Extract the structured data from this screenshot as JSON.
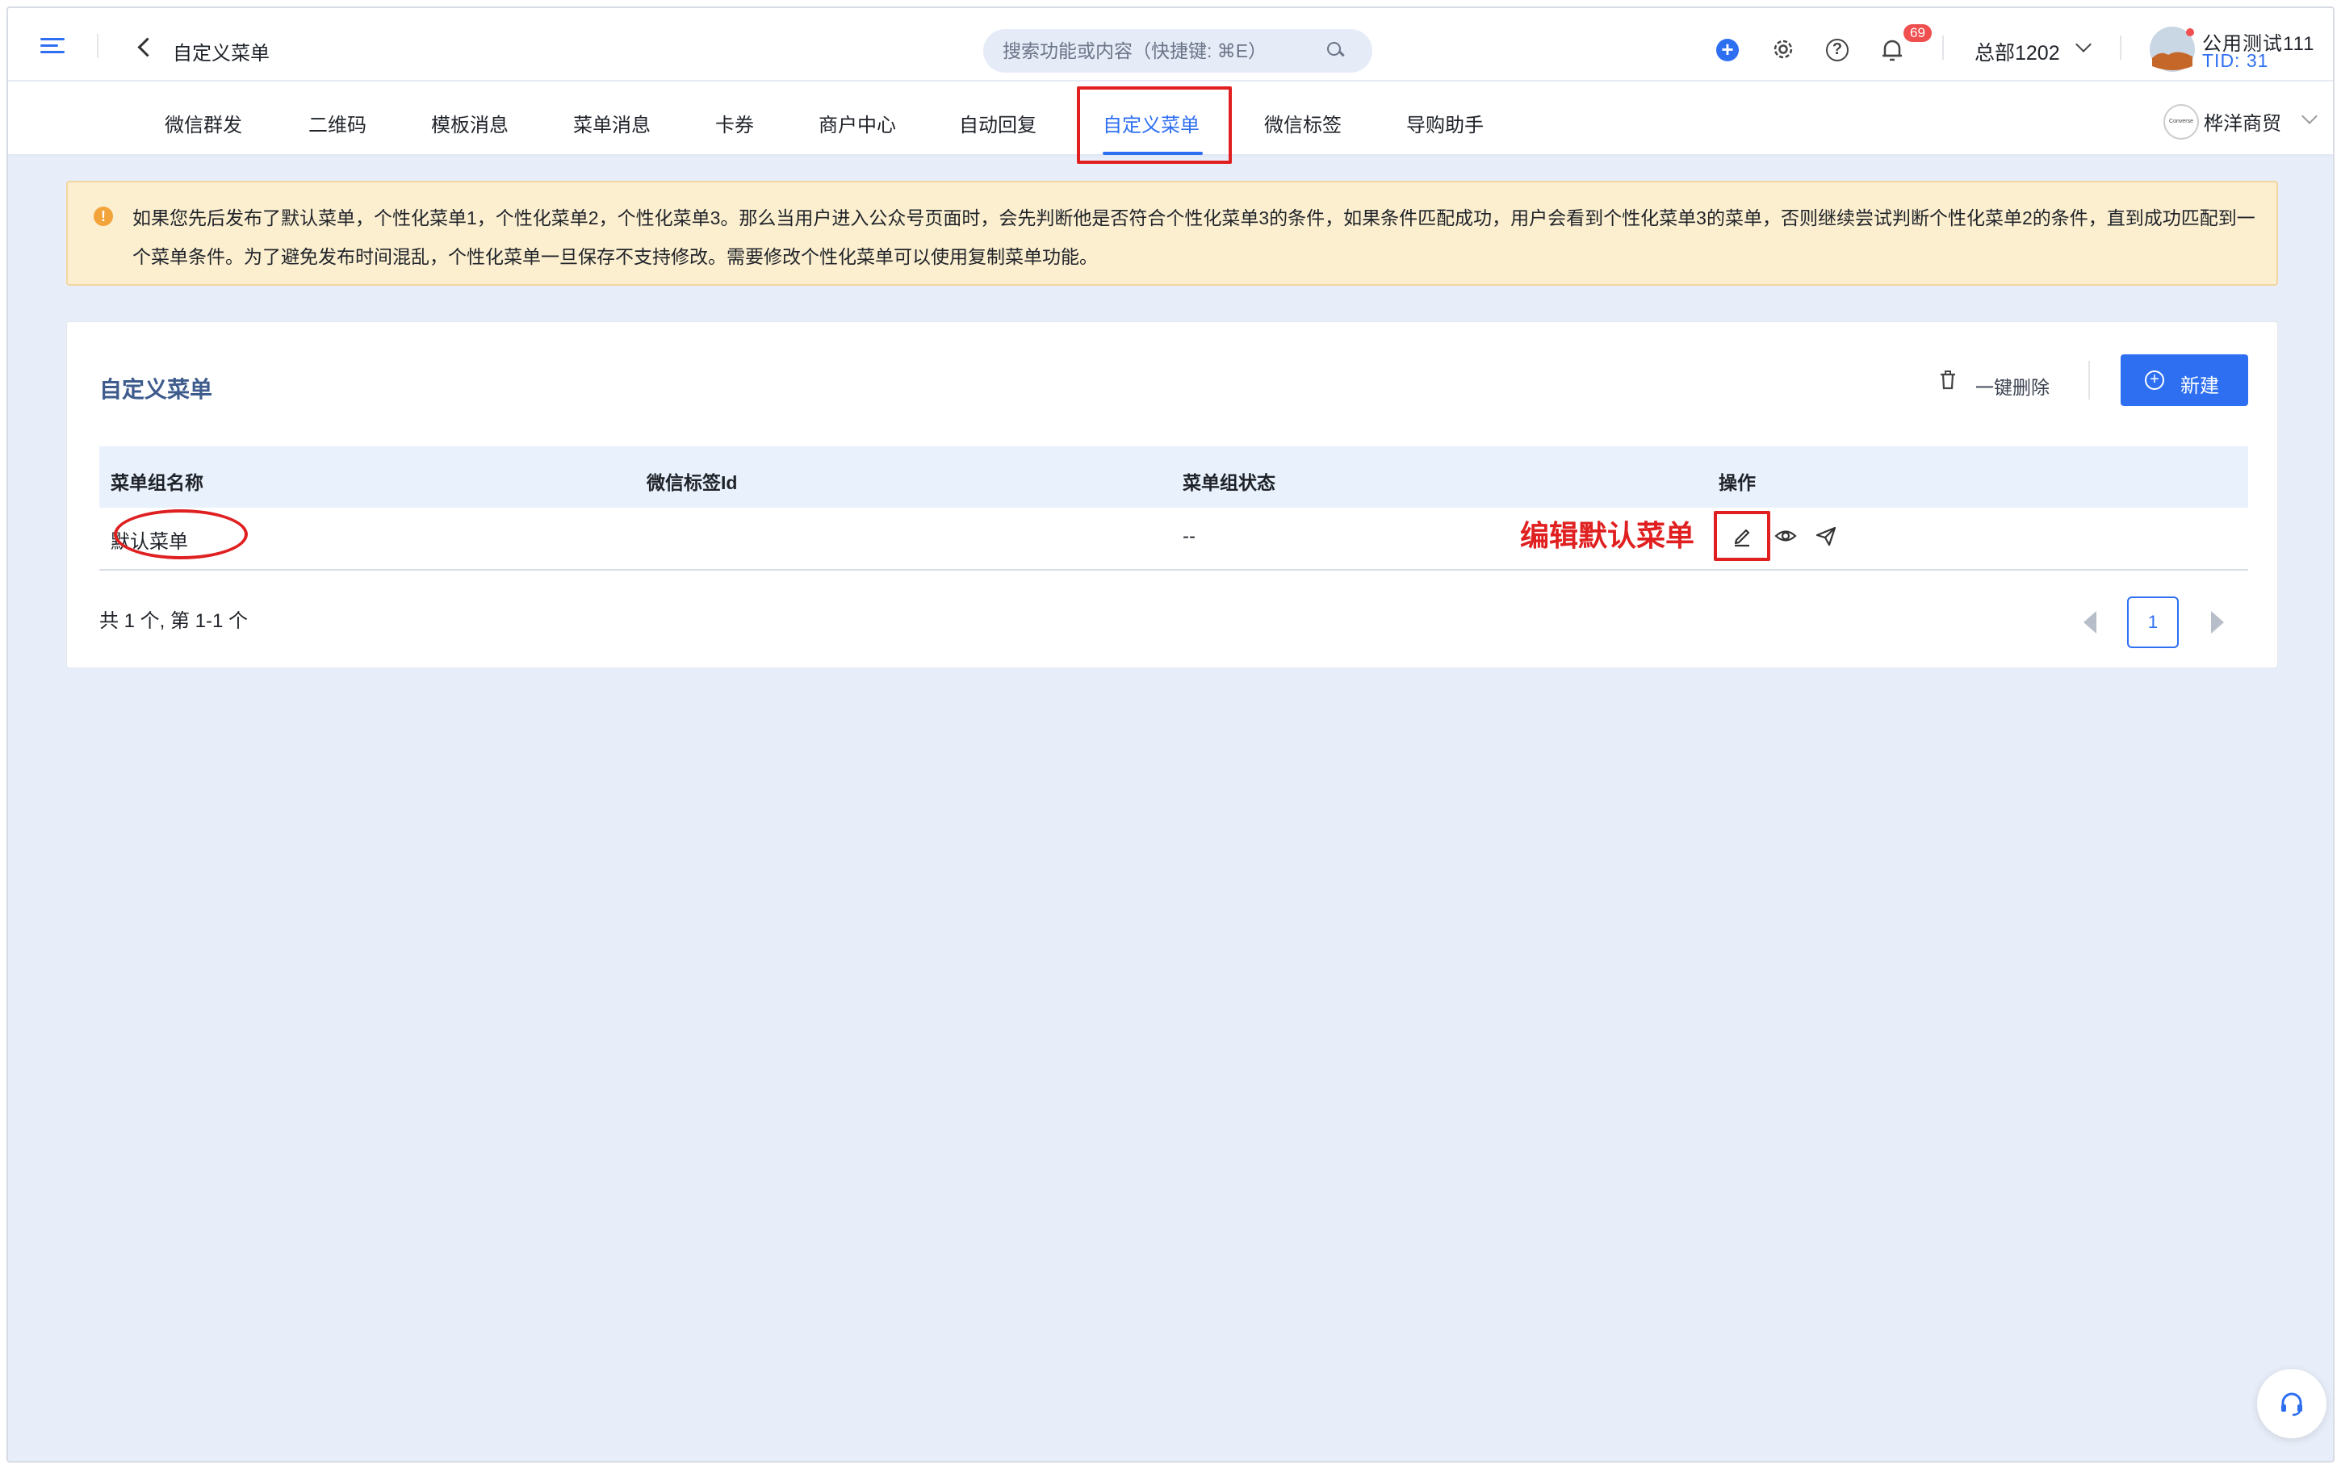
{
  "topbar": {
    "page_title": "自定义菜单",
    "search_placeholder": "搜索功能或内容（快捷键: ⌘E）",
    "notification_count": "69",
    "department": "总部1202",
    "user_name": "公用测试111",
    "user_tid": "TID: 31"
  },
  "tabs": [
    {
      "label": "微信群发"
    },
    {
      "label": "二维码"
    },
    {
      "label": "模板消息"
    },
    {
      "label": "菜单消息"
    },
    {
      "label": "卡券"
    },
    {
      "label": "商户中心"
    },
    {
      "label": "自动回复"
    },
    {
      "label": "自定义菜单",
      "active": true
    },
    {
      "label": "微信标签"
    },
    {
      "label": "导购助手"
    }
  ],
  "store": {
    "name": "桦洋商贸",
    "logo_text": "Converse"
  },
  "notice": {
    "text": "如果您先后发布了默认菜单，个性化菜单1，个性化菜单2，个性化菜单3。那么当用户进入公众号页面时，会先判断他是否符合个性化菜单3的条件，如果条件匹配成功，用户会看到个性化菜单3的菜单，否则继续尝试判断个性化菜单2的条件，直到成功匹配到一个菜单条件。为了避免发布时间混乱，个性化菜单一旦保存不支持修改。需要修改个性化菜单可以使用复制菜单功能。"
  },
  "card": {
    "title": "自定义菜单",
    "bulk_delete_label": "一键删除",
    "new_label": "新建",
    "columns": [
      "菜单组名称",
      "微信标签Id",
      "菜单组状态",
      "操作"
    ],
    "rows": [
      {
        "name": "默认菜单",
        "tag_id": "",
        "status": "--"
      }
    ],
    "annotation": "编辑默认菜单",
    "total_text": "共 1 个, 第 1-1 个",
    "current_page": "1"
  },
  "colors": {
    "accent": "#2e6ff2",
    "annotation_red": "#e02020",
    "notice_bg": "#fcefd0",
    "page_bg": "#e8eef9"
  },
  "icons": [
    "menu-icon",
    "back-icon",
    "search-icon",
    "plus-circle-icon",
    "gear-icon",
    "help-icon",
    "bell-icon",
    "chevron-down-icon",
    "warning-icon",
    "trash-icon",
    "plus-icon",
    "edit-icon",
    "eye-icon",
    "send-icon",
    "prev-page-icon",
    "next-page-icon",
    "headset-icon"
  ]
}
